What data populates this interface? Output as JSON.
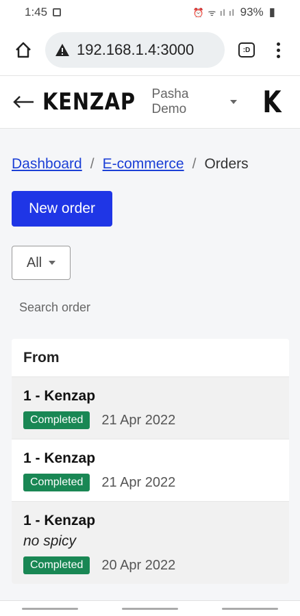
{
  "status": {
    "time": "1:45",
    "battery": "93%"
  },
  "browser": {
    "url": "192.168.1.4:3000",
    "tabs_label": ":D"
  },
  "header": {
    "brand": "KENZAP",
    "user": "Pasha Demo",
    "logo": "K"
  },
  "breadcrumb": {
    "items": [
      "Dashboard",
      "E-commerce"
    ],
    "current": "Orders",
    "sep": "/"
  },
  "actions": {
    "new_order": "New order"
  },
  "filter": {
    "value": "All"
  },
  "search": {
    "placeholder": "Search order"
  },
  "table": {
    "header": "From",
    "rows": [
      {
        "title": "1 - Kenzap",
        "note": "",
        "status": "Completed",
        "date": "21 Apr 2022"
      },
      {
        "title": "1 - Kenzap",
        "note": "",
        "status": "Completed",
        "date": "21 Apr 2022"
      },
      {
        "title": "1 - Kenzap",
        "note": "no spicy",
        "status": "Completed",
        "date": "20 Apr 2022"
      }
    ]
  },
  "colors": {
    "primary": "#1f36e6",
    "success": "#198754",
    "link": "#1b3fd6"
  }
}
